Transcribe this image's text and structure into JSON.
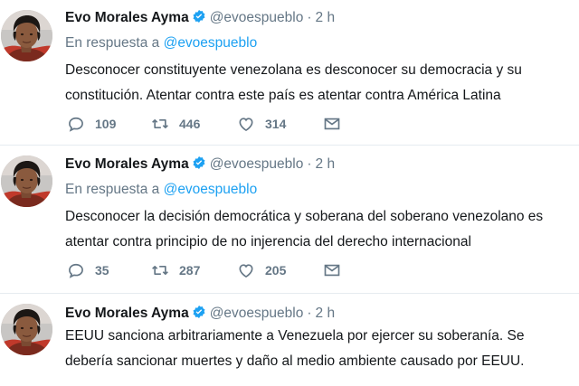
{
  "colors": {
    "text": "#14171a",
    "secondary": "#657786",
    "link": "#1da1f2",
    "divider": "#e6ecf0",
    "verified": "#1da1f2"
  },
  "tweets": [
    {
      "author_name": "Evo Morales Ayma",
      "handle": "@evoespueblo",
      "separator": "·",
      "time": "2 h",
      "reply_prefix": "En respuesta a",
      "reply_to": "@evoespueblo",
      "text_lines": [
        "Desconocer constituyente venezolana es desconocer su democracia y su",
        "constitución. Atentar contra este país es atentar contra América Latina"
      ],
      "stats": {
        "replies": "109",
        "retweets": "446",
        "likes": "314"
      },
      "icons": [
        "reply-icon",
        "retweet-icon",
        "like-icon",
        "direct-message-icon"
      ]
    },
    {
      "author_name": "Evo Morales Ayma",
      "handle": "@evoespueblo",
      "separator": "·",
      "time": "2 h",
      "reply_prefix": "En respuesta a",
      "reply_to": "@evoespueblo",
      "text_lines": [
        "Desconocer la decisión democrática y soberana del soberano venezolano es",
        "atentar contra principio de no injerencia del derecho internacional"
      ],
      "stats": {
        "replies": "35",
        "retweets": "287",
        "likes": "205"
      },
      "icons": [
        "reply-icon",
        "retweet-icon",
        "like-icon",
        "direct-message-icon"
      ]
    },
    {
      "author_name": "Evo Morales Ayma",
      "handle": "@evoespueblo",
      "separator": "·",
      "time": "2 h",
      "text_lines": [
        "EEUU sanciona arbitrariamente a Venezuela por ejercer su soberanía. Se",
        "debería sancionar muertes y daño al medio ambiente causado por EEUU."
      ]
    }
  ]
}
